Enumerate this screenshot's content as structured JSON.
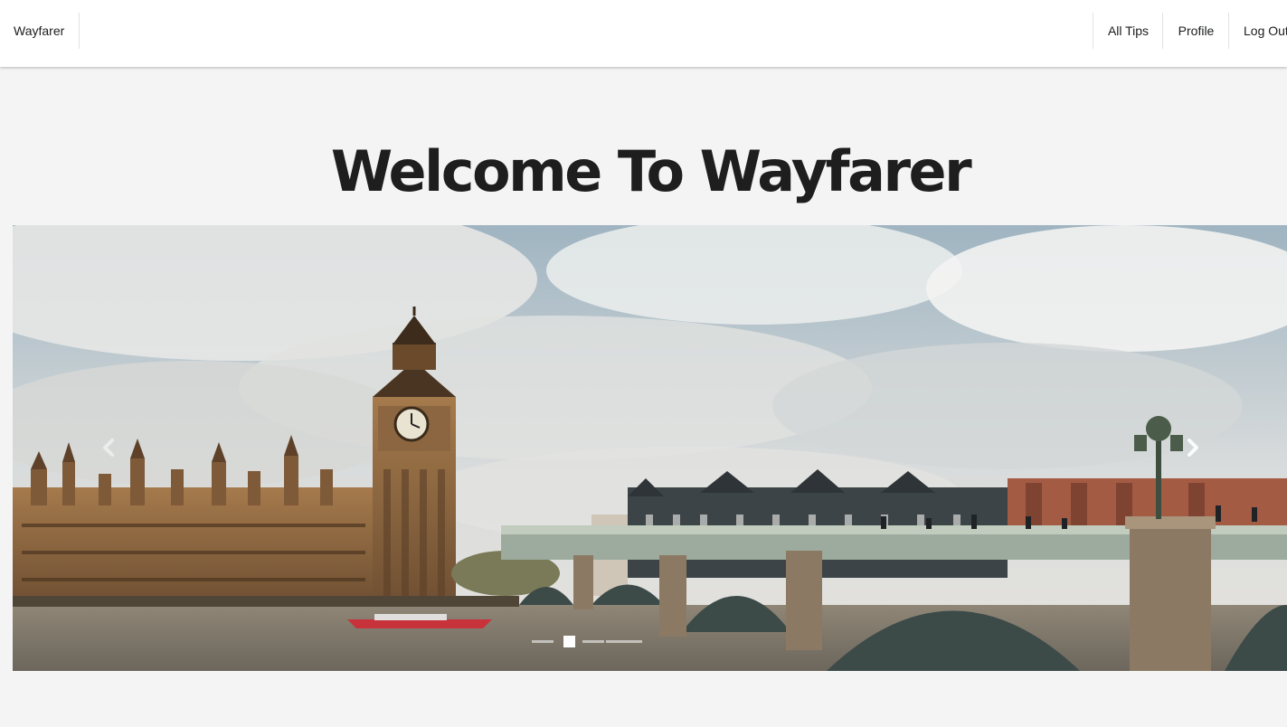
{
  "navbar": {
    "brand": "Wayfarer",
    "links": {
      "all_tips": "All Tips",
      "profile": "Profile",
      "log_out": "Log Out"
    }
  },
  "main": {
    "title": "Welcome To Wayfarer"
  },
  "carousel": {
    "slide_count": 5,
    "active_index": 1,
    "image_subject": "London skyline with Big Ben and Westminster Bridge"
  },
  "colors": {
    "page_background": "#f4f4f4",
    "navbar_background": "#ffffff",
    "heading_text": "#1e1e1e"
  }
}
